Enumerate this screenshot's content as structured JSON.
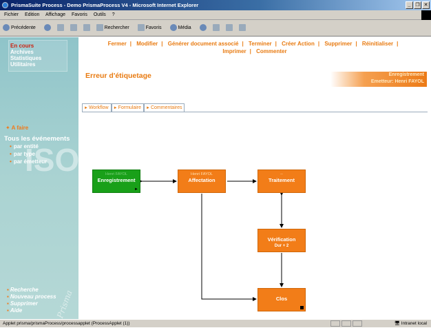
{
  "window": {
    "title": "PrismaSuite Process - Demo PrismaProcess V4 - Microsoft Internet Explorer",
    "buttons": [
      "_",
      "❐",
      "✕"
    ]
  },
  "menu": [
    "Fichier",
    "Edition",
    "Affichage",
    "Favoris",
    "Outils",
    "?"
  ],
  "toolbar": {
    "back": "Précédente",
    "search": "Rechercher",
    "favorites": "Favoris",
    "media": "Média"
  },
  "sidebar": {
    "top_links": [
      "En cours",
      "Archives",
      "Statistiques",
      "Utilitaires"
    ],
    "a_faire": "A faire",
    "all_events": "Tous les événements",
    "filters": [
      "par entité",
      "par type",
      "par émetteur"
    ],
    "watermark": "ISO",
    "brand": "Prisma",
    "bottom_links": [
      "Recherche",
      "Nouveau process",
      "Supprimer",
      "Aide"
    ]
  },
  "actions": [
    "Fermer",
    "Modifier",
    "Générer document associé",
    "Terminer",
    "Créer Action",
    "Supprimer",
    "Réinitialiser",
    "Imprimer",
    "Commenter"
  ],
  "page": {
    "title": "Erreur d'étiquetage",
    "info_line1": "Enregistrement",
    "info_line2": "Emetteur: Henri FAYOL"
  },
  "tabs": [
    "Workflow",
    "Formulaire",
    "Commentaires"
  ],
  "workflow": {
    "nodes": [
      {
        "top": "Henri FAYOL",
        "label": "Enregistrement",
        "sub": ""
      },
      {
        "top": "Henri FAYOL",
        "label": "Affectation",
        "sub": ""
      },
      {
        "top": "--",
        "label": "Traitement",
        "sub": ""
      },
      {
        "top": "",
        "label": "Vérification",
        "sub": "Dur + 2"
      },
      {
        "top": "",
        "label": "Clos",
        "sub": ""
      }
    ]
  },
  "status": {
    "left": "Applet prisma/prismaProcess/processapplet (ProcessApplet (1))",
    "zone": "Intranet local"
  }
}
